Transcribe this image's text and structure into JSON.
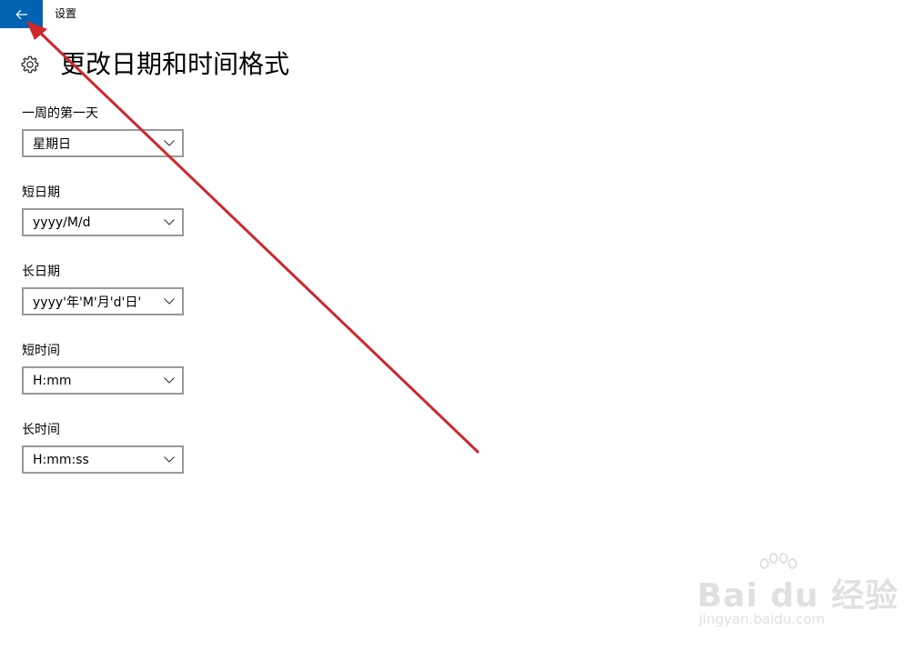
{
  "window": {
    "title": "设置"
  },
  "header": {
    "title": "更改日期和时间格式"
  },
  "settings": [
    {
      "label": "一周的第一天",
      "value": "星期日"
    },
    {
      "label": "短日期",
      "value": "yyyy/M/d"
    },
    {
      "label": "长日期",
      "value": "yyyy'年'M'月'd'日'"
    },
    {
      "label": "短时间",
      "value": "H:mm"
    },
    {
      "label": "长时间",
      "value": "H:mm:ss"
    }
  ],
  "watermark": {
    "main": "Bai du 经验",
    "sub": "jingyan.baidu.com"
  },
  "colors": {
    "accent": "#0063b1",
    "annotation": "#d0262c",
    "combo_border": "#999999"
  },
  "icons": {
    "back": "back-arrow-icon",
    "settings": "gear-icon",
    "dropdown": "chevron-down-icon"
  }
}
